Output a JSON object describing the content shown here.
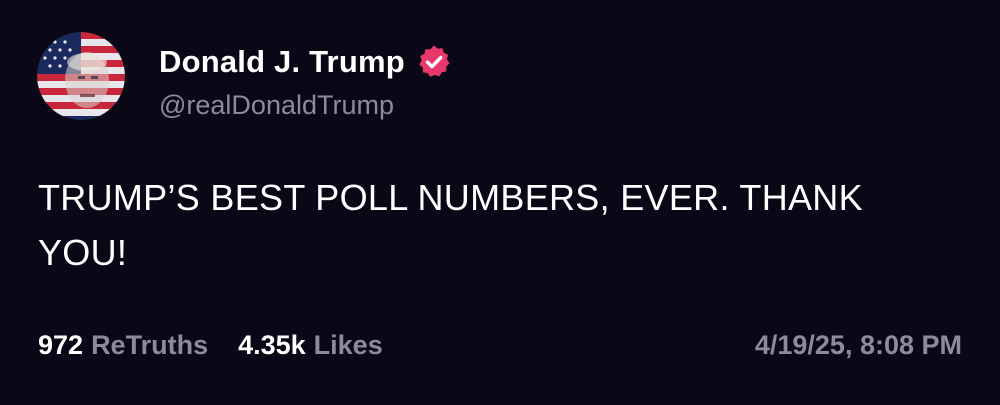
{
  "author": {
    "display_name": "Donald J. Trump",
    "handle": "@realDonaldTrump",
    "verified": true,
    "verified_icon": "verified-badge-icon",
    "verified_color": "#e8386b"
  },
  "post": {
    "text": "TRUMP’S BEST POLL NUMBERS, EVER. THANK YOU!"
  },
  "stats": {
    "retruths_count": "972",
    "retruths_label": "ReTruths",
    "likes_count": "4.35k",
    "likes_label": "Likes"
  },
  "timestamp": "4/19/25, 8:08 PM",
  "colors": {
    "background": "#0a0817",
    "primary_text": "#ffffff",
    "secondary_text": "#8d8a9e"
  }
}
